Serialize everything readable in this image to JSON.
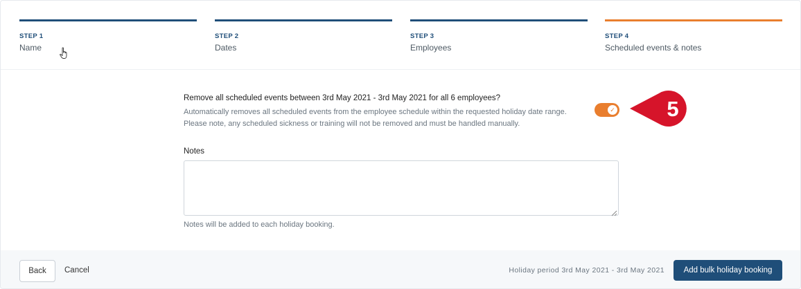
{
  "steps": [
    {
      "num": "STEP 1",
      "label": "Name"
    },
    {
      "num": "STEP 2",
      "label": "Dates"
    },
    {
      "num": "STEP 3",
      "label": "Employees"
    },
    {
      "num": "STEP 4",
      "label": "Scheduled events & notes"
    }
  ],
  "remove_events": {
    "question": "Remove all scheduled events between 3rd May 2021 - 3rd May 2021 for all 6 employees?",
    "description_line1": "Automatically removes all scheduled events from the employee schedule within the requested holiday date range.",
    "description_line2": "Please note, any scheduled sickness or training will not be removed and must be handled manually.",
    "toggle_on": true
  },
  "marker": {
    "number": "5"
  },
  "notes": {
    "label": "Notes",
    "value": "",
    "help": "Notes will be added to each holiday booking."
  },
  "footer": {
    "back_label": "Back",
    "cancel_label": "Cancel",
    "period_text": "Holiday period 3rd May 2021 - 3rd May 2021",
    "submit_label": "Add bulk holiday booking"
  },
  "colors": {
    "primary": "#1f4e79",
    "accent": "#e97e2e",
    "marker": "#d6142a"
  }
}
